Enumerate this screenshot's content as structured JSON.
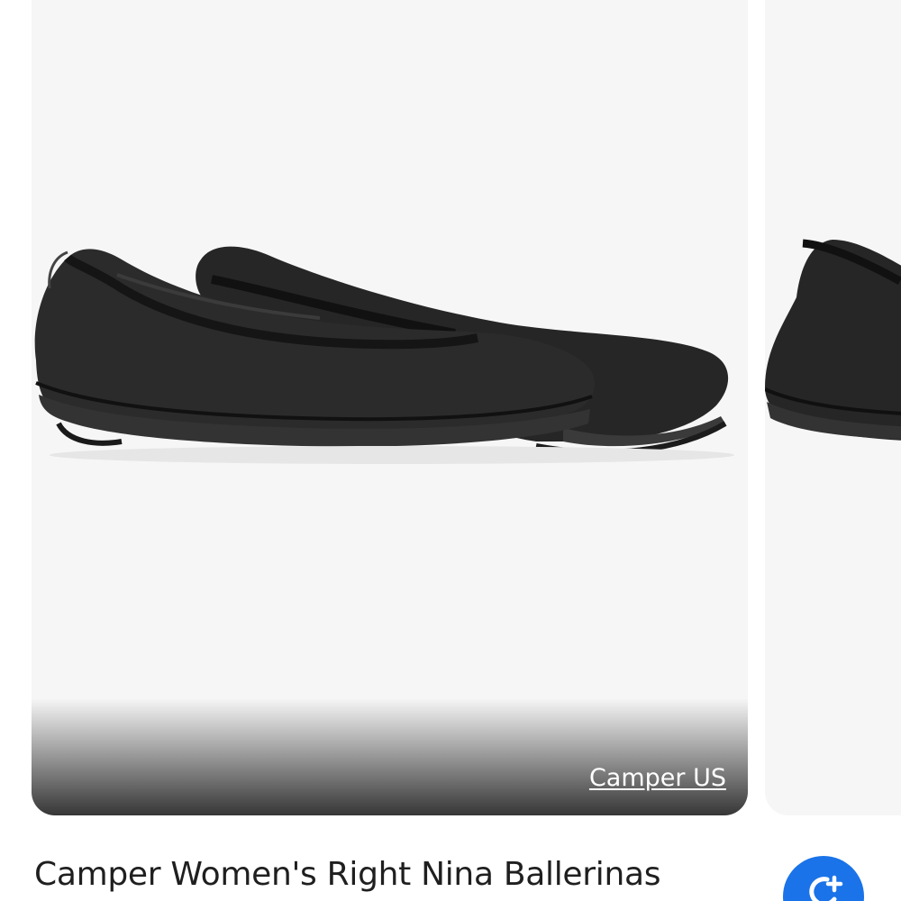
{
  "main_card": {
    "image_alt": "Black leather ballerina flats",
    "source": "Camper US"
  },
  "product": {
    "title": "Camper Women's Right Nina Ballerinas"
  },
  "actions": {
    "add_icon": "add-to-collection-icon"
  },
  "colors": {
    "card_background": "#f6f6f6",
    "accent_button": "#1a73e8",
    "title_text": "#1f1f1f",
    "link_text": "#ffffff"
  }
}
